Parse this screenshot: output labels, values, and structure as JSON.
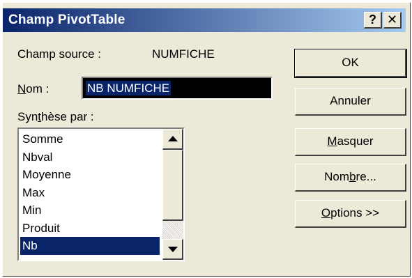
{
  "window": {
    "title": "Champ PivotTable",
    "help_label": "?",
    "close_label": "✕"
  },
  "source": {
    "label": "Champ source :",
    "value": "NUMFICHE"
  },
  "name": {
    "label_prefix": "N",
    "label_rest": "om :",
    "value": "NB NUMFICHE"
  },
  "summary": {
    "label_prefix": "Syn",
    "label_underlined": "t",
    "label_rest": "hèse par :",
    "items": [
      "Somme",
      "Nbval",
      "Moyenne",
      "Max",
      "Min",
      "Produit",
      "Nb"
    ],
    "selected": "Nb"
  },
  "buttons": {
    "ok": "OK",
    "cancel": "Annuler",
    "hide_u": "M",
    "hide_rest": "asquer",
    "number_pre": "Nom",
    "number_u": "b",
    "number_rest": "re...",
    "options_u": "O",
    "options_rest": "ptions >>"
  }
}
